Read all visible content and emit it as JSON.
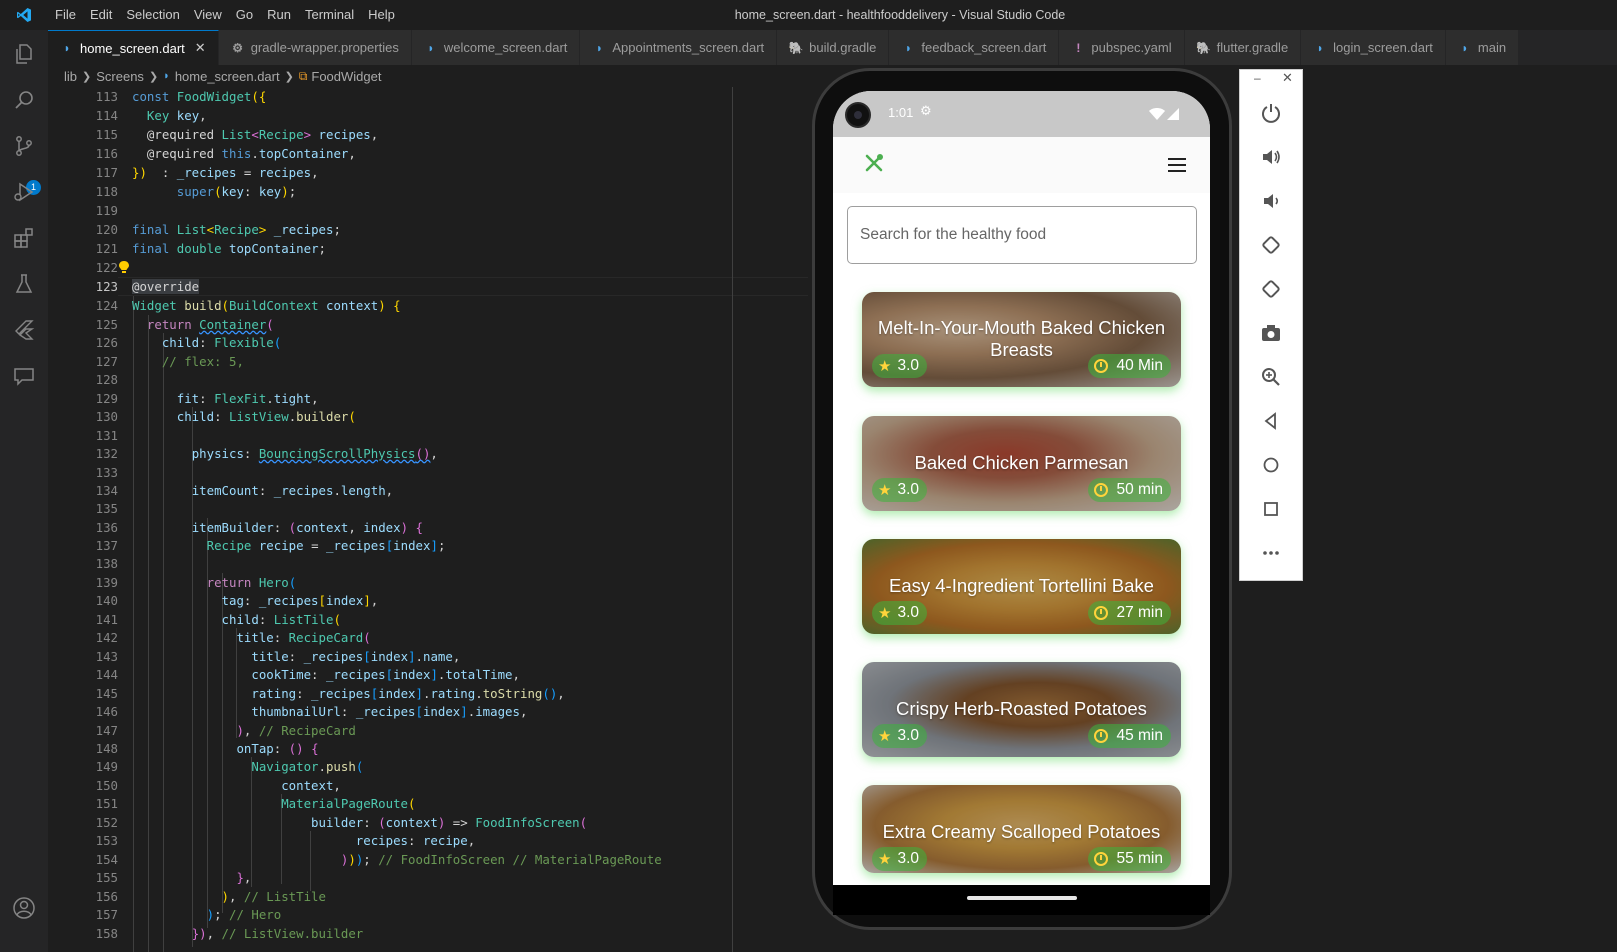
{
  "window": {
    "title": "home_screen.dart - healthfooddelivery - Visual Studio Code",
    "menu": [
      "File",
      "Edit",
      "Selection",
      "View",
      "Go",
      "Run",
      "Terminal",
      "Help"
    ]
  },
  "activity_bar": {
    "icons": [
      "explorer-icon",
      "search-icon",
      "source-control-icon",
      "run-debug-icon",
      "extensions-icon",
      "testing-icon",
      "flutter-icon",
      "comments-icon",
      "account-icon"
    ],
    "scm_badge": "1"
  },
  "tabs": [
    {
      "label": "home_screen.dart",
      "icon": "dart-icon",
      "active": true,
      "close": "✕"
    },
    {
      "label": "gradle-wrapper.properties",
      "icon": "gear-icon",
      "active": false
    },
    {
      "label": "welcome_screen.dart",
      "icon": "dart-icon",
      "active": false
    },
    {
      "label": "Appointments_screen.dart",
      "icon": "dart-icon",
      "active": false
    },
    {
      "label": "build.gradle",
      "icon": "gradle-icon",
      "active": false
    },
    {
      "label": "feedback_screen.dart",
      "icon": "dart-icon",
      "active": false
    },
    {
      "label": "pubspec.yaml",
      "icon": "yaml-icon",
      "active": false
    },
    {
      "label": "flutter.gradle",
      "icon": "gradle-icon",
      "active": false
    },
    {
      "label": "login_screen.dart",
      "icon": "dart-icon",
      "active": false
    },
    {
      "label": "main",
      "icon": "dart-icon",
      "active": false
    }
  ],
  "breadcrumb": {
    "parts": [
      "lib",
      "Screens",
      "home_screen.dart",
      "FoodWidget"
    ]
  },
  "editor": {
    "current_line": 123,
    "line_numbers": [
      "113",
      "114",
      "115",
      "116",
      "117",
      "118",
      "119",
      "120",
      "121",
      "122",
      "123",
      "124",
      "125",
      "126",
      "127",
      "128",
      "129",
      "130",
      "131",
      "132",
      "133",
      "134",
      "135",
      "136",
      "137",
      "138",
      "139",
      "140",
      "141",
      "142",
      "143",
      "144",
      "145",
      "146",
      "147",
      "148",
      "149",
      "150",
      "151",
      "152",
      "153",
      "154",
      "155",
      "156",
      "157",
      "158"
    ]
  },
  "emulator": {
    "status_time": "1:01",
    "search_placeholder": "Search for the healthy food",
    "cards": [
      {
        "title": "Melt-In-Your-Mouth Baked Chicken Breasts",
        "rating": "3.0",
        "time": "40 Min"
      },
      {
        "title": "Baked Chicken Parmesan",
        "rating": "3.0",
        "time": "50 min"
      },
      {
        "title": "Easy 4-Ingredient Tortellini Bake",
        "rating": "3.0",
        "time": "27 min"
      },
      {
        "title": "Crispy Herb-Roasted Potatoes",
        "rating": "3.0",
        "time": "45 min"
      },
      {
        "title": "Extra Creamy Scalloped Potatoes",
        "rating": "3.0",
        "time": "55 min"
      }
    ],
    "panel": {
      "minimize": "–",
      "close": "✕",
      "buttons": [
        "power-icon",
        "volume-up-icon",
        "volume-down-icon",
        "rotate-left-icon",
        "rotate-right-icon",
        "camera-icon",
        "zoom-icon",
        "back-icon",
        "home-icon",
        "overview-icon",
        "more-icon"
      ]
    }
  },
  "colors": {
    "accent": "#007acc",
    "brand_green": "#4caf50",
    "star": "#ffd43b"
  }
}
